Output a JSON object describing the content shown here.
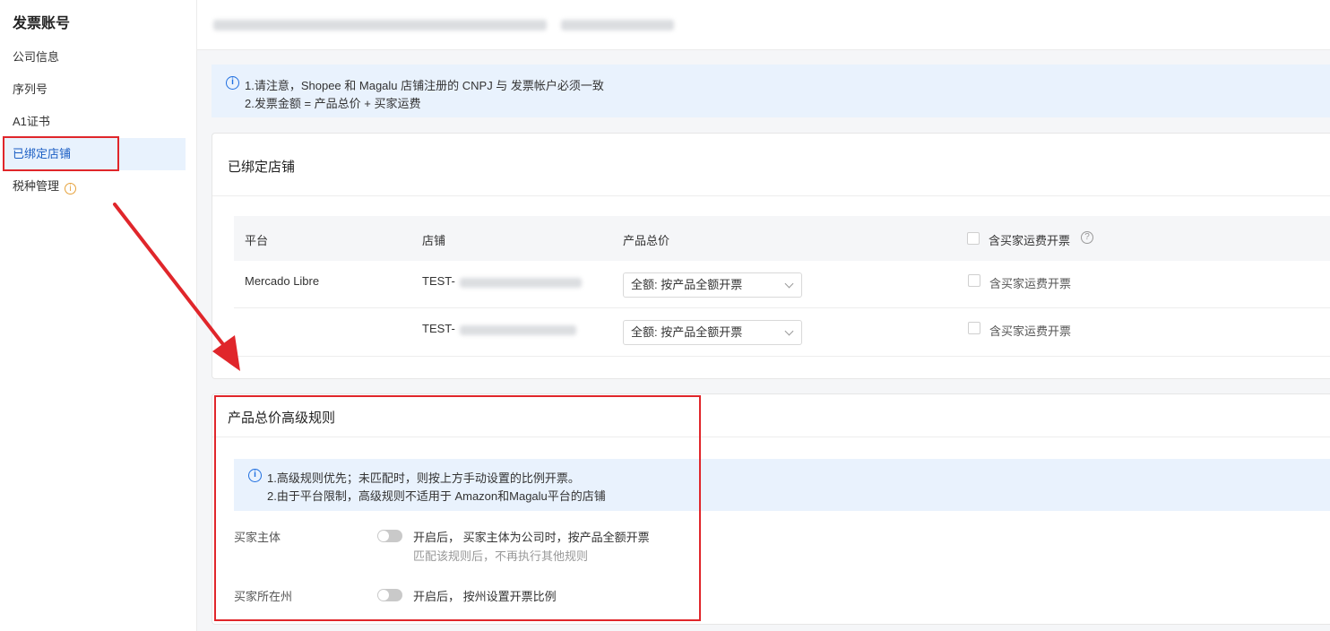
{
  "sidebar": {
    "title": "发票账号",
    "items": [
      {
        "label": "公司信息"
      },
      {
        "label": "序列号"
      },
      {
        "label": "A1证书"
      },
      {
        "label": "已绑定店铺"
      },
      {
        "label": "税种管理"
      }
    ],
    "warn_icon": "i"
  },
  "notice": {
    "icon": "i",
    "line1": "1.请注意，Shopee 和 Magalu 店铺注册的 CNPJ 与 发票帐户必须一致",
    "line2": "2.发票金额 = 产品总价 + 买家运费"
  },
  "stores": {
    "title": "已绑定店铺",
    "columns": {
      "platform": "平台",
      "store": "店铺",
      "price": "产品总价",
      "freight": "含买家运费开票"
    },
    "help_icon": "?",
    "rows": [
      {
        "platform": "Mercado Libre",
        "store": "TEST-",
        "price": "全额: 按产品全额开票",
        "freight": "含买家运费开票"
      },
      {
        "platform": "",
        "store": "TEST-",
        "price": "全额: 按产品全额开票",
        "freight": "含买家运费开票"
      }
    ]
  },
  "advanced": {
    "title": "产品总价高级规则",
    "icon": "i",
    "notice_line1": "1.高级规则优先；未匹配时，则按上方手动设置的比例开票。",
    "notice_line2": "2.由于平台限制，高级规则不适用于 Amazon和Magalu平台的店铺",
    "rules": [
      {
        "label": "买家主体",
        "desc": "开启后， 买家主体为公司时，按产品全额开票",
        "sub": "匹配该规则后，不再执行其他规则",
        "enabled": false
      },
      {
        "label": "买家所在州",
        "desc": "开启后， 按州设置开票比例",
        "sub": "",
        "enabled": false
      }
    ]
  }
}
